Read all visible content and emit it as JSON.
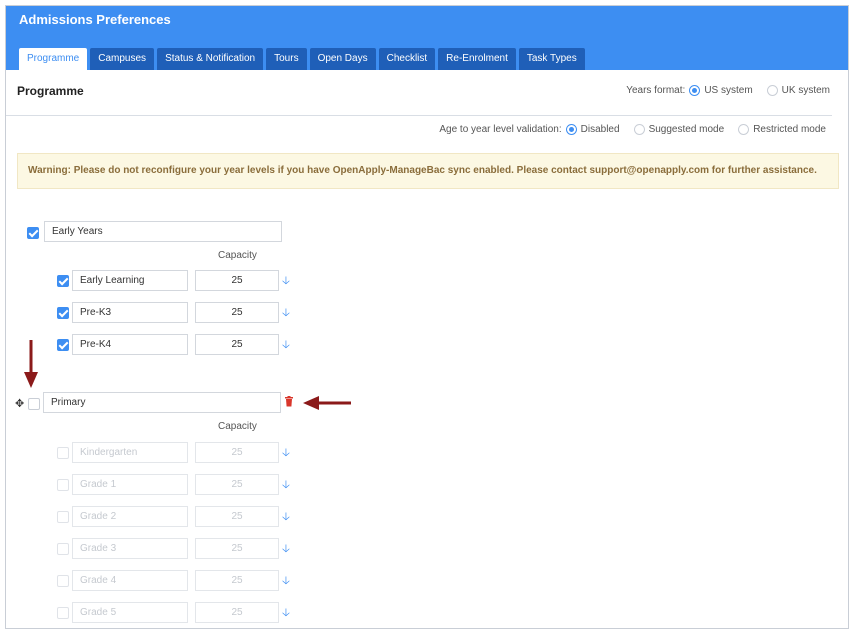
{
  "header": {
    "title": "Admissions Preferences",
    "tabs": [
      "Programme",
      "Campuses",
      "Status & Notification",
      "Tours",
      "Open Days",
      "Checklist",
      "Re-Enrolment",
      "Task Types"
    ],
    "active_tab": "Programme"
  },
  "section": {
    "title": "Programme",
    "years_format_label": "Years format:",
    "years_format_options": [
      "US system",
      "UK system"
    ],
    "years_format_selected": "US system",
    "validation_label": "Age to year level validation:",
    "validation_options": [
      "Disabled",
      "Suggested mode",
      "Restricted mode"
    ],
    "validation_selected": "Disabled"
  },
  "warning": "Warning: Please do not reconfigure your year levels if you have OpenApply-ManageBac sync enabled. Please contact support@openapply.com for further assistance.",
  "capacity_label": "Capacity",
  "groups": [
    {
      "name": "Early Years",
      "checked": true,
      "levels": [
        {
          "name": "Early Learning",
          "capacity": "25",
          "checked": true
        },
        {
          "name": "Pre-K3",
          "capacity": "25",
          "checked": true
        },
        {
          "name": "Pre-K4",
          "capacity": "25",
          "checked": true
        }
      ]
    },
    {
      "name": "Primary",
      "checked": false,
      "levels": [
        {
          "name": "Kindergarten",
          "capacity": "25",
          "checked": false
        },
        {
          "name": "Grade 1",
          "capacity": "25",
          "checked": false
        },
        {
          "name": "Grade 2",
          "capacity": "25",
          "checked": false
        },
        {
          "name": "Grade 3",
          "capacity": "25",
          "checked": false
        },
        {
          "name": "Grade 4",
          "capacity": "25",
          "checked": false
        },
        {
          "name": "Grade 5",
          "capacity": "25",
          "checked": false
        }
      ]
    }
  ],
  "colors": {
    "header": "#3d8ef2",
    "tab": "#1f5fb8",
    "annotation_arrow": "#8b1a1a",
    "warning_bg": "#fcf8e3",
    "delete": "#d9362b"
  },
  "icons": [
    "move-icon",
    "trash-icon",
    "arrow-down-icon"
  ]
}
